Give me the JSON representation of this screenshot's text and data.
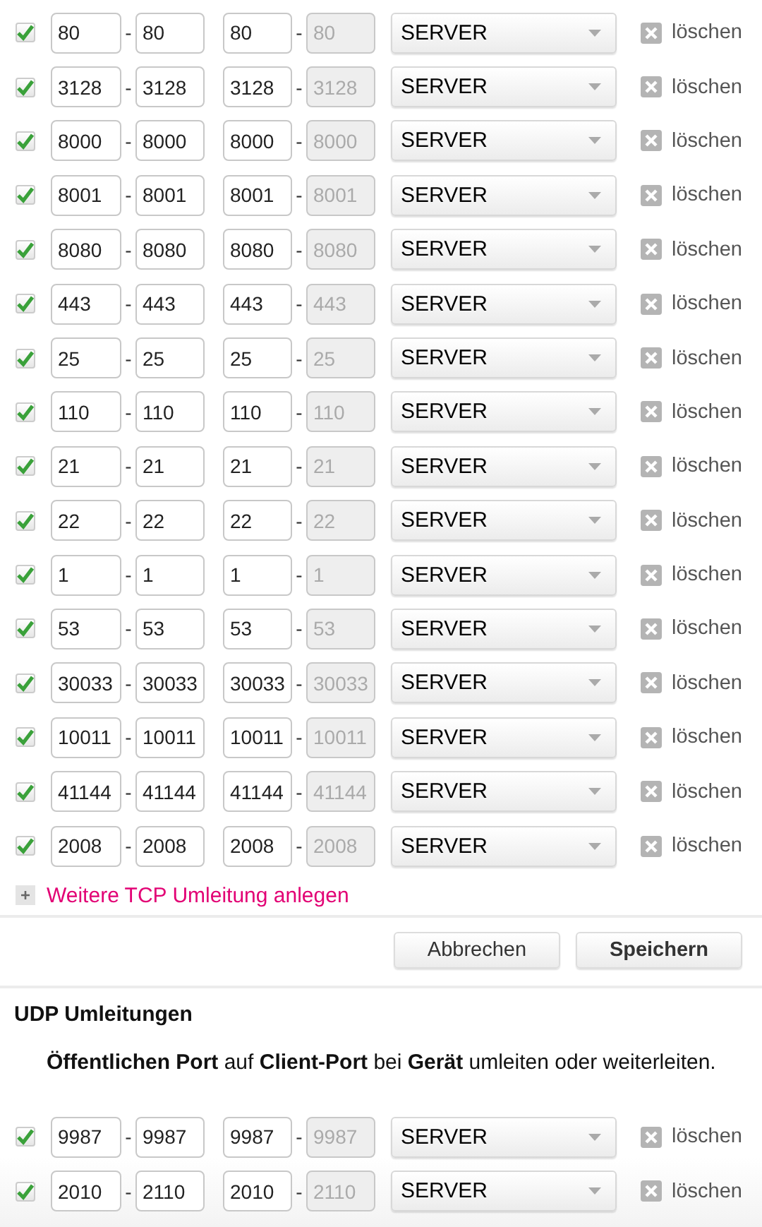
{
  "tcp_rows": [
    {
      "checked": true,
      "ports": [
        {
          "value": "80",
          "disabled": false
        },
        {
          "value": "80",
          "disabled": false
        },
        {
          "value": "80",
          "disabled": false
        },
        {
          "value": "80",
          "disabled": true
        }
      ],
      "device": "SERVER",
      "delete": "löschen"
    },
    {
      "checked": true,
      "ports": [
        {
          "value": "3128",
          "disabled": false
        },
        {
          "value": "3128",
          "disabled": false
        },
        {
          "value": "3128",
          "disabled": false
        },
        {
          "value": "3128",
          "disabled": true
        }
      ],
      "device": "SERVER",
      "delete": "löschen"
    },
    {
      "checked": true,
      "ports": [
        {
          "value": "8000",
          "disabled": false
        },
        {
          "value": "8000",
          "disabled": false
        },
        {
          "value": "8000",
          "disabled": false
        },
        {
          "value": "8000",
          "disabled": true
        }
      ],
      "device": "SERVER",
      "delete": "löschen"
    },
    {
      "checked": true,
      "ports": [
        {
          "value": "8001",
          "disabled": false
        },
        {
          "value": "8001",
          "disabled": false
        },
        {
          "value": "8001",
          "disabled": false
        },
        {
          "value": "8001",
          "disabled": true
        }
      ],
      "device": "SERVER",
      "delete": "löschen"
    },
    {
      "checked": true,
      "ports": [
        {
          "value": "8080",
          "disabled": false
        },
        {
          "value": "8080",
          "disabled": false
        },
        {
          "value": "8080",
          "disabled": false
        },
        {
          "value": "8080",
          "disabled": true
        }
      ],
      "device": "SERVER",
      "delete": "löschen"
    },
    {
      "checked": true,
      "ports": [
        {
          "value": "443",
          "disabled": false
        },
        {
          "value": "443",
          "disabled": false
        },
        {
          "value": "443",
          "disabled": false
        },
        {
          "value": "443",
          "disabled": true
        }
      ],
      "device": "SERVER",
      "delete": "löschen"
    },
    {
      "checked": true,
      "ports": [
        {
          "value": "25",
          "disabled": false
        },
        {
          "value": "25",
          "disabled": false
        },
        {
          "value": "25",
          "disabled": false
        },
        {
          "value": "25",
          "disabled": true
        }
      ],
      "device": "SERVER",
      "delete": "löschen"
    },
    {
      "checked": true,
      "ports": [
        {
          "value": "110",
          "disabled": false
        },
        {
          "value": "110",
          "disabled": false
        },
        {
          "value": "110",
          "disabled": false
        },
        {
          "value": "110",
          "disabled": true
        }
      ],
      "device": "SERVER",
      "delete": "löschen"
    },
    {
      "checked": true,
      "ports": [
        {
          "value": "21",
          "disabled": false
        },
        {
          "value": "21",
          "disabled": false
        },
        {
          "value": "21",
          "disabled": false
        },
        {
          "value": "21",
          "disabled": true
        }
      ],
      "device": "SERVER",
      "delete": "löschen"
    },
    {
      "checked": true,
      "ports": [
        {
          "value": "22",
          "disabled": false
        },
        {
          "value": "22",
          "disabled": false
        },
        {
          "value": "22",
          "disabled": false
        },
        {
          "value": "22",
          "disabled": true
        }
      ],
      "device": "SERVER",
      "delete": "löschen"
    },
    {
      "checked": true,
      "ports": [
        {
          "value": "1",
          "disabled": false
        },
        {
          "value": "1",
          "disabled": false
        },
        {
          "value": "1",
          "disabled": false
        },
        {
          "value": "1",
          "disabled": true
        }
      ],
      "device": "SERVER",
      "delete": "löschen"
    },
    {
      "checked": true,
      "ports": [
        {
          "value": "53",
          "disabled": false
        },
        {
          "value": "53",
          "disabled": false
        },
        {
          "value": "53",
          "disabled": false
        },
        {
          "value": "53",
          "disabled": true
        }
      ],
      "device": "SERVER",
      "delete": "löschen"
    },
    {
      "checked": true,
      "ports": [
        {
          "value": "30033",
          "disabled": false
        },
        {
          "value": "30033",
          "disabled": false
        },
        {
          "value": "30033",
          "disabled": false
        },
        {
          "value": "30033",
          "disabled": true
        }
      ],
      "device": "SERVER",
      "delete": "löschen"
    },
    {
      "checked": true,
      "ports": [
        {
          "value": "10011",
          "disabled": false
        },
        {
          "value": "10011",
          "disabled": false
        },
        {
          "value": "10011",
          "disabled": false
        },
        {
          "value": "10011",
          "disabled": true
        }
      ],
      "device": "SERVER",
      "delete": "löschen"
    },
    {
      "checked": true,
      "ports": [
        {
          "value": "41144",
          "disabled": false
        },
        {
          "value": "41144",
          "disabled": false
        },
        {
          "value": "41144",
          "disabled": false
        },
        {
          "value": "41144",
          "disabled": true
        }
      ],
      "device": "SERVER",
      "delete": "löschen"
    },
    {
      "checked": true,
      "ports": [
        {
          "value": "2008",
          "disabled": false
        },
        {
          "value": "2008",
          "disabled": false
        },
        {
          "value": "2008",
          "disabled": false
        },
        {
          "value": "2008",
          "disabled": true
        }
      ],
      "device": "SERVER",
      "delete": "löschen"
    }
  ],
  "separator": "-",
  "add_link": "Weitere TCP Umleitung anlegen",
  "buttons": [
    {
      "label": "Abbrechen",
      "primary": false
    },
    {
      "label": "Speichern",
      "primary": true
    }
  ],
  "udp": {
    "title": "UDP Umleitungen",
    "description": "**Öffentlichen Port** auf **Client-Port** bei **Gerät** umleiten oder weiterleiten.",
    "rows": [
      {
        "checked": true,
        "ports": [
          {
            "value": "9987",
            "disabled": false
          },
          {
            "value": "9987",
            "disabled": false
          },
          {
            "value": "9987",
            "disabled": false
          },
          {
            "value": "9987",
            "disabled": true
          }
        ],
        "device": "SERVER",
        "delete": "löschen"
      },
      {
        "checked": true,
        "ports": [
          {
            "value": "2010",
            "disabled": false
          },
          {
            "value": "2110",
            "disabled": false
          },
          {
            "value": "2010",
            "disabled": false
          },
          {
            "value": "2110",
            "disabled": true
          }
        ],
        "device": "SERVER",
        "delete": "löschen"
      }
    ]
  }
}
